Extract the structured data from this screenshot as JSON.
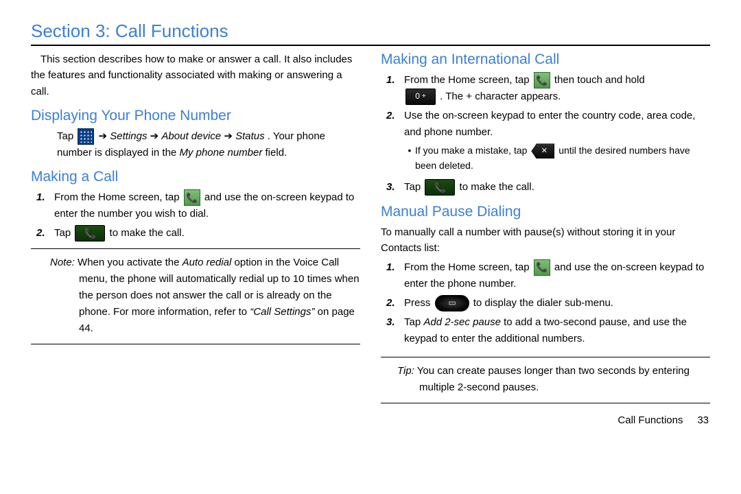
{
  "title": "Section 3: Call Functions",
  "left": {
    "intro": "This section describes how to make or answer a call. It also includes the features and functionality associated with making or answering a call.",
    "h1": "Displaying Your Phone Number",
    "p1a": "Tap ",
    "p1_settings": "Settings",
    "p1_arrow": " ➔ ",
    "p1_about": "About device",
    "p1_status": "Status",
    "p1b": ". Your phone number is displayed in the ",
    "p1_field": "My phone number",
    "p1c": " field.",
    "h2": "Making a Call",
    "s1_a": "From the Home screen, tap ",
    "s1_b": " and use the on-screen keypad to enter the number you wish to dial.",
    "s2_a": "Tap ",
    "s2_b": " to make the call.",
    "note_label": "Note:",
    "note_a": " When you activate the ",
    "note_autoredial": "Auto redial",
    "note_b": " option in the Voice Call menu, the phone will automatically redial up to 10 times when the person does not answer the call or is already on the phone. For more information, refer to ",
    "note_ref": "“Call Settings”",
    "note_c": " on page 44."
  },
  "right": {
    "h1": "Making an International Call",
    "i1_a": "From the Home screen, tap ",
    "i1_b": " then touch and hold ",
    "i1_c": ". The ",
    "i1_plus": "+",
    "i1_d": " character appears.",
    "i2": "Use the on-screen keypad to enter the country code, area code, and phone number.",
    "i_bullet_a": "If you make a mistake, tap ",
    "i_bullet_b": " until the desired numbers have been deleted.",
    "i3_a": "Tap ",
    "i3_b": " to make the call.",
    "h2": "Manual Pause Dialing",
    "mp_intro": "To manually call a number with pause(s) without storing it in your Contacts list:",
    "m1_a": "From the Home screen, tap ",
    "m1_b": " and use the on-screen keypad to enter the phone number.",
    "m2_a": "Press ",
    "m2_b": " to display the dialer sub-menu.",
    "m3_a": "Tap ",
    "m3_add": "Add 2-sec pause",
    "m3_b": " to add a two-second pause, and use the keypad to enter the additional numbers.",
    "tip_label": "Tip:",
    "tip_body": " You can create pauses longer than two seconds by entering multiple 2-second pauses."
  },
  "icons": {
    "apps": "apps-grid",
    "phone_tile": "📞",
    "phone_btn": "📞",
    "zero_key": "0 +",
    "backspace": "✕",
    "menu_hw": "▭"
  },
  "footer": {
    "label": "Call Functions",
    "page": "33"
  }
}
